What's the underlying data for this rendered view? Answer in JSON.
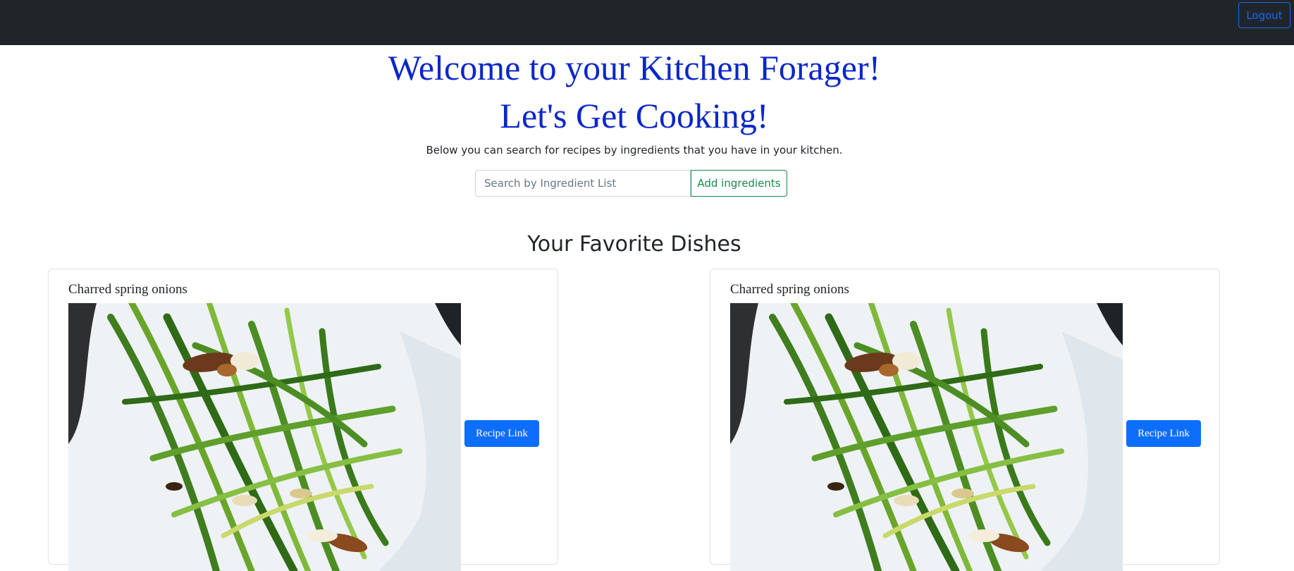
{
  "navbar": {
    "logout_label": "Logout"
  },
  "hero": {
    "title_line1": "Welcome to your Kitchen Forager!",
    "title_line2": "Let's Get Cooking!",
    "subtitle": "Below you can search for recipes by ingredients that you have in your kitchen."
  },
  "search": {
    "placeholder": "Search by Ingredient List",
    "value": "",
    "add_button_label": "Add ingredients"
  },
  "favorites": {
    "heading": "Your Favorite Dishes",
    "cards": [
      {
        "title": "Charred spring onions",
        "button_label": "Recipe Link",
        "image_icon": "food-photo"
      },
      {
        "title": "Charred spring onions",
        "button_label": "Recipe Link",
        "image_icon": "food-photo"
      }
    ]
  },
  "colors": {
    "navbar_bg": "#212529",
    "heading_blue": "#0b27c9",
    "primary_blue": "#0d6efd",
    "success_green": "#198754"
  }
}
